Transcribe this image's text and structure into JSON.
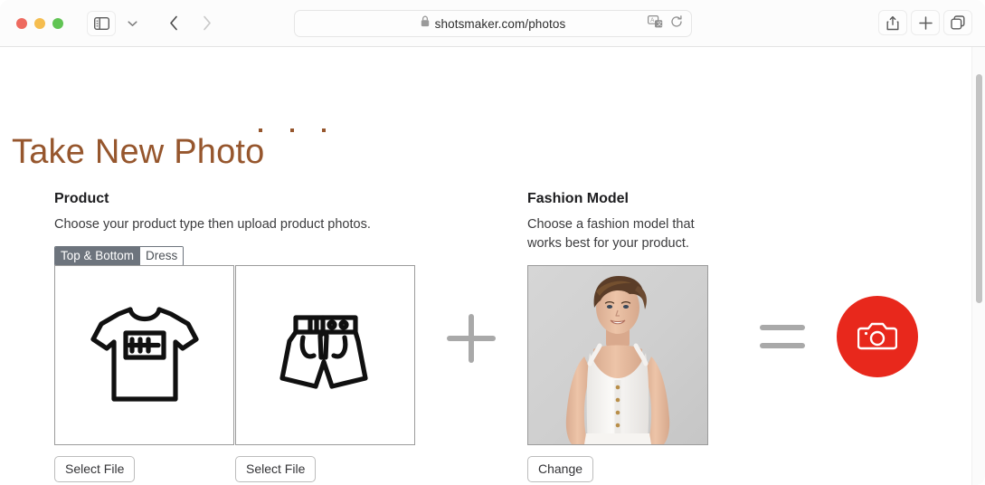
{
  "browser": {
    "traffic_lights": {
      "close_color": "#ee6a5f",
      "minimize_color": "#f5bd4f",
      "maximize_color": "#61c454"
    },
    "sidebar_toggle_label": "Show sidebar",
    "sidebar_dropdown_label": "Sidebar options",
    "back_label": "Back",
    "forward_label": "Forward",
    "address": {
      "url": "shotsmaker.com/photos",
      "lock_label": "Secure connection",
      "translate_label": "Translate",
      "reload_label": "Reload"
    },
    "share_label": "Share",
    "new_tab_label": "New Tab",
    "tab_overview_label": "Tab Overview"
  },
  "page": {
    "title": "Take New Photo",
    "title_color": "#96562d",
    "title_dots": [
      "·",
      "·",
      "·"
    ]
  },
  "product": {
    "heading": "Product",
    "description": "Choose your product type then upload product photos.",
    "segmented": {
      "options": [
        "Top & Bottom",
        "Dress"
      ],
      "selected": "Top & Bottom",
      "selected_bg": "#6d747d"
    },
    "items": [
      {
        "icon": "tshirt-icon",
        "button_label": "Select File"
      },
      {
        "icon": "shorts-icon",
        "button_label": "Select File"
      }
    ]
  },
  "operators": {
    "plus": "+",
    "equals": "=",
    "color": "#a9a9a9"
  },
  "model": {
    "heading": "Fashion Model",
    "description": "Choose a fashion model that works best for your product.",
    "photo_alt": "Fashion model wearing white button-front tank top and white pants",
    "change_label": "Change"
  },
  "capture": {
    "icon": "camera-icon",
    "accent_color": "#e8281c",
    "label": "Take photo"
  },
  "scrollbar": {
    "thumb_color": "#c3c3c3"
  }
}
